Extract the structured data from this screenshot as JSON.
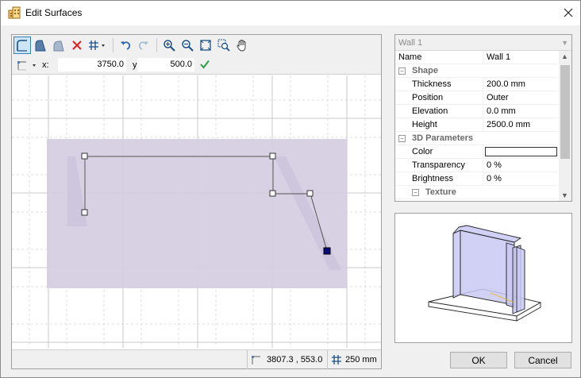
{
  "window": {
    "title": "Edit Surfaces"
  },
  "coords": {
    "x_label": "x:",
    "x_value": "3750.0",
    "y_label": "y:",
    "y_value": "500.0"
  },
  "status": {
    "position": "3807.3 , 553.0",
    "grid": "250 mm"
  },
  "props": {
    "selector": "Wall 1",
    "rows": [
      {
        "kind": "prop",
        "name": "Name",
        "value": "Wall 1",
        "indent": 0
      },
      {
        "kind": "cat",
        "name": "Shape"
      },
      {
        "kind": "prop",
        "name": "Thickness",
        "value": "200.0 mm",
        "indent": 1
      },
      {
        "kind": "prop",
        "name": "Position",
        "value": "Outer",
        "indent": 1
      },
      {
        "kind": "prop",
        "name": "Elevation",
        "value": "0.0 mm",
        "indent": 1
      },
      {
        "kind": "prop",
        "name": "Height",
        "value": "2500.0 mm",
        "indent": 1
      },
      {
        "kind": "cat",
        "name": "3D Parameters"
      },
      {
        "kind": "color",
        "name": "Color",
        "value": "",
        "indent": 1
      },
      {
        "kind": "prop",
        "name": "Transparency",
        "value": "0 %",
        "indent": 1
      },
      {
        "kind": "prop",
        "name": "Brightness",
        "value": "0 %",
        "indent": 1
      },
      {
        "kind": "subcat",
        "name": "Texture"
      }
    ]
  },
  "buttons": {
    "ok": "OK",
    "cancel": "Cancel"
  },
  "colors": {
    "surface_fill": "#d5cde2",
    "wall_line": "#555555",
    "active_node": "#0a0a7a",
    "accent": "#3c7fb1",
    "preview_wall": "#c9c9f5"
  }
}
